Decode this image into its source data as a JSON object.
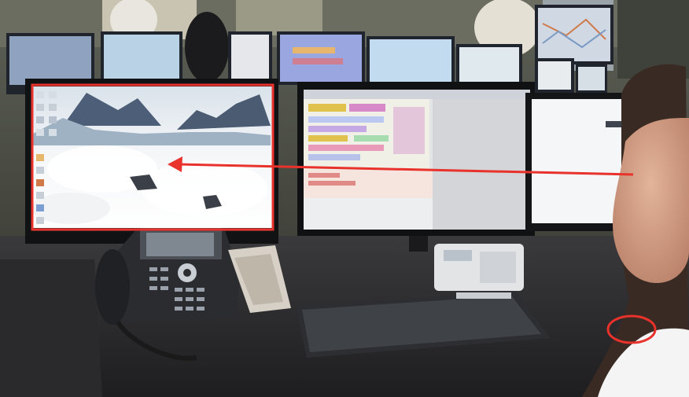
{
  "scene": {
    "annotation_color": "#e8322b",
    "elements": [
      "office-workstation",
      "left-monitor-desktop",
      "center-monitor-app",
      "right-monitor",
      "desk-phone",
      "phone-keypad",
      "keyboard",
      "computer-mouse",
      "operator-person"
    ],
    "annotations": [
      "highlight-rectangle-left-monitor",
      "arrow-from-person-to-monitor",
      "circle-around-mouse"
    ]
  }
}
